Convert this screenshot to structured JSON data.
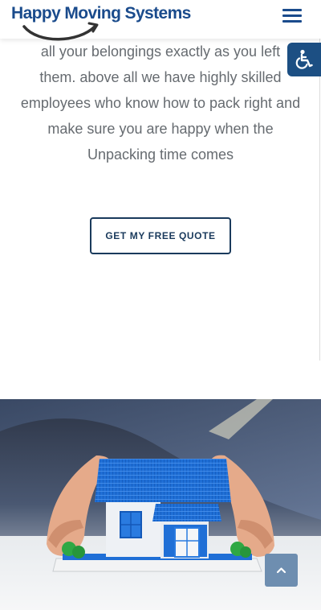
{
  "brand": {
    "name": "Happy Moving Systems"
  },
  "header": {
    "menu_icon": "hamburger-menu-icon"
  },
  "accessibility": {
    "icon": "accessibility-wheelchair-icon"
  },
  "intro": {
    "lines": [
      "all your belongings exactly as you left",
      "them. above all we have highly skilled",
      "employees who know how to pack right and",
      "make sure you are happy when the",
      "Unpacking time comes"
    ]
  },
  "cta": {
    "label": "GET MY FREE QUOTE"
  },
  "back_to_top": {
    "icon": "chevron-up-icon"
  },
  "colors": {
    "brand_blue": "#1a4b8c",
    "button_border": "#1a3a5c",
    "accessibility_bg": "#1c4f83",
    "back_to_top_bg": "#6e8eb0",
    "body_text": "#666b70"
  }
}
